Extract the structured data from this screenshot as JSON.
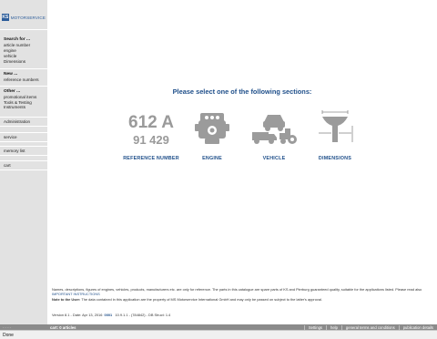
{
  "logo": {
    "badge": "KS",
    "name": "MOTORSERVICE"
  },
  "sidebar": {
    "search_head": "Search for ...",
    "search_items": [
      "article number",
      "engine",
      "vehicle",
      "Dimensions"
    ],
    "new_head": "New ...",
    "new_items": [
      "reference numbers"
    ],
    "other_head": "Other ...",
    "other_items": [
      "promotional items",
      "Tools & Testing",
      "Instruments"
    ],
    "blocks": [
      "Administration",
      "service",
      "memory list",
      "cart"
    ]
  },
  "main": {
    "title": "Please select one of the following sections:",
    "sections": [
      {
        "label": "REFERENCE NUMBER",
        "icon_text_top": "612 A",
        "icon_text_bottom": "91 429",
        "icon": "part-number-icon"
      },
      {
        "label": "ENGINE",
        "icon": "engine-icon"
      },
      {
        "label": "VEHICLE",
        "icon": "vehicle-icon"
      },
      {
        "label": "DIMENSIONS",
        "icon": "dimensions-icon"
      }
    ]
  },
  "footer": {
    "line1": "Names, descriptions, figures of engines, vehicles, products, manufacturers etc. are only for reference. The parts in this catalogue are spare parts of KS and Pierburg guaranteed quality, suitable for the applications listed. Please read also",
    "instructions_link": "IMPORTANT INSTRUCTIONS",
    "note_label": "Note to the User:",
    "note_text": "The data contained in this application are the property of MS Motorservice International GmbH and may only be passed on subject to the latter's approval.",
    "version_prefix": "Version 8.1   - Date: Apr 13, 2016",
    "version_num": "0001",
    "version_suffix": "10.9.1.1 - (784842) - DB Struct: 1.4"
  },
  "bottom_bar": {
    "left": "- - - -",
    "cart": "cart: 0 articles",
    "nav": [
      "Settings",
      "help",
      "general terms and conditions",
      "publication details"
    ]
  },
  "status": {
    "text": "Done"
  },
  "colors": {
    "accent": "#1f4f8a",
    "sidebar_bg": "#e2e2e2",
    "bar_bg": "#8b8b8b"
  }
}
